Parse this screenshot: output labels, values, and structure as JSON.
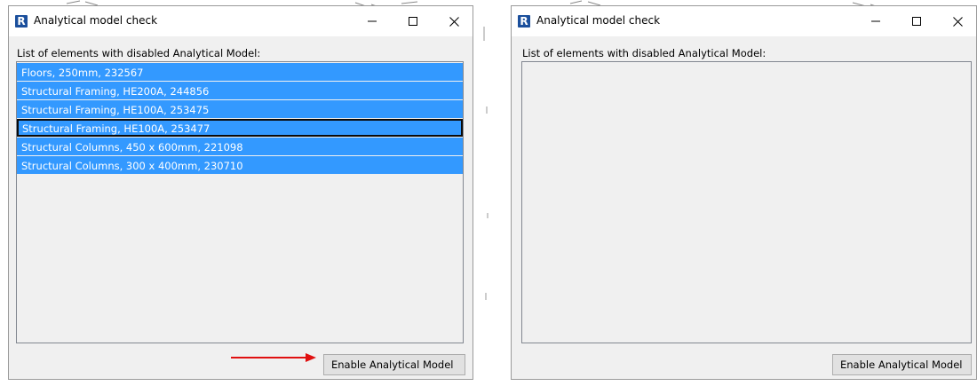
{
  "colors": {
    "selection": "#3399ff",
    "window_bg": "#f0f0f0",
    "arrow": "#e01010",
    "app_icon": "#1b4f9c"
  },
  "left_window": {
    "app_icon_letter": "R",
    "title": "Analytical model check",
    "list_label": "List of elements with disabled Analytical Model:",
    "items": [
      "Floors, 250mm, 232567",
      "Structural Framing, HE200A, 244856",
      "Structural Framing, HE100A, 253475",
      "Structural Framing, HE100A, 253477",
      "Structural Columns, 450 x 600mm, 221098",
      "Structural Columns, 300 x 400mm, 230710"
    ],
    "focused_item_index": 3,
    "button_label": "Enable Analytical Model",
    "annotation": "red-arrow-pointing-to-button"
  },
  "right_window": {
    "app_icon_letter": "R",
    "title": "Analytical model check",
    "list_label": "List of elements with disabled Analytical Model:",
    "items": [],
    "button_label": "Enable Analytical Model"
  },
  "icons": {
    "minimize": "minimize-icon",
    "maximize": "maximize-icon",
    "close": "close-icon"
  }
}
